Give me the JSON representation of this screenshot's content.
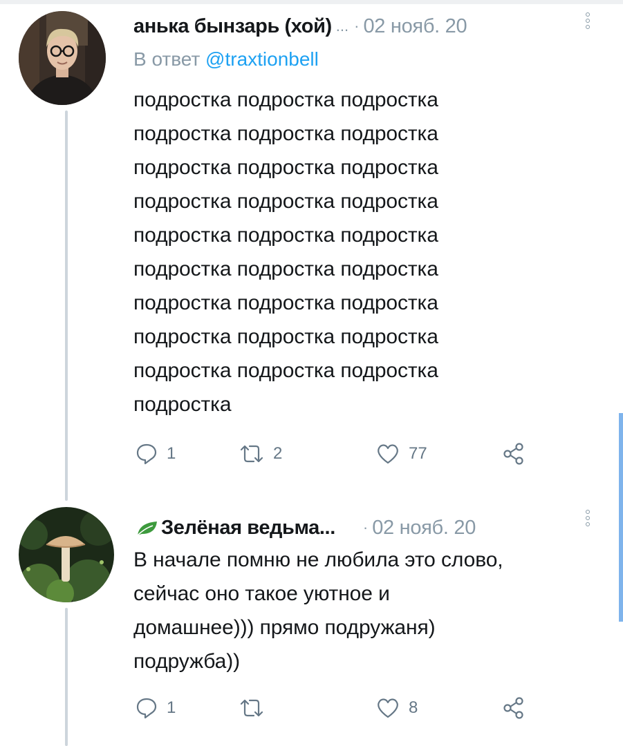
{
  "tweets": [
    {
      "author": "анька бынзарь (хой)",
      "truncation": "...",
      "separator": "·",
      "date": "02 нояб. 20",
      "reply_prefix": "В ответ ",
      "reply_handle": "@traxtionbell",
      "lines": [
        "подростка подростка подростка",
        "подростка подростка подростка",
        "подростка подростка подростка",
        "подростка подростка подростка",
        "подростка подростка подростка",
        "подростка подростка подростка",
        "подростка подростка подростка",
        "подростка подростка подростка",
        "подростка подростка подростка",
        "подростка"
      ],
      "replies": "1",
      "retweets": "2",
      "likes": "77"
    },
    {
      "author": "Зелёная ведьма...",
      "author_icon": "leaf-icon",
      "separator": "·",
      "date": "02 нояб. 20",
      "lines": [
        "В начале помню не любила это слово,",
        "сейчас оно такое уютное и",
        "домашнее))) прямо подружаня)",
        "подружба))"
      ],
      "replies": "1",
      "retweets": "",
      "likes": "8"
    }
  ],
  "icons": {
    "reply": "reply-icon",
    "retweet": "retweet-icon",
    "like": "heart-icon",
    "share": "share-icon",
    "menu": "more-options-icon"
  },
  "colors": {
    "text": "#14171a",
    "secondary": "#8899a6",
    "link": "#1da1f2",
    "thread_line": "#cdd5dc",
    "leaf": "#3d9a3d"
  }
}
